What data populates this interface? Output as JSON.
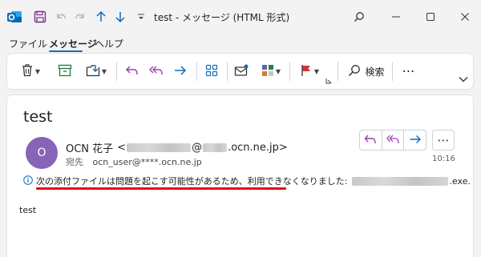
{
  "window": {
    "title": "test  -  メッセージ (HTML 形式)",
    "app_icon": "outlook-icon"
  },
  "colors": {
    "accent": "#0f6cbd",
    "avatar_bg": "#8764b8",
    "flag_red": "#d13438",
    "highlight_underline": "#e0101a"
  },
  "menu": {
    "items": [
      "ファイル",
      "メッセージ",
      "ヘルプ"
    ],
    "active": "メッセージ"
  },
  "ribbon": {
    "search_label": "検索",
    "buttons": [
      "delete-icon",
      "archive-icon",
      "move-icon",
      "reply-icon",
      "reply-all-icon",
      "forward-icon",
      "apps-icon",
      "mark-unread-icon",
      "categorize-icon",
      "flag-icon",
      "search-icon",
      "more-icon",
      "expand-ribbon-icon"
    ]
  },
  "message": {
    "subject": "test",
    "avatar_initial": "O",
    "sender_name": "OCN 花子",
    "sender_open": "<",
    "sender_at": "@",
    "sender_domain": ".ocn.ne.jp>",
    "to_label": "宛先",
    "to_address": "ocn_user@****.ocn.ne.jp",
    "time": "10:16",
    "info_text": "次の添付ファイルは問題を起こす可能性があるため、利用できなくなりました:",
    "attachment_ext": ".exe.",
    "body": "test"
  }
}
